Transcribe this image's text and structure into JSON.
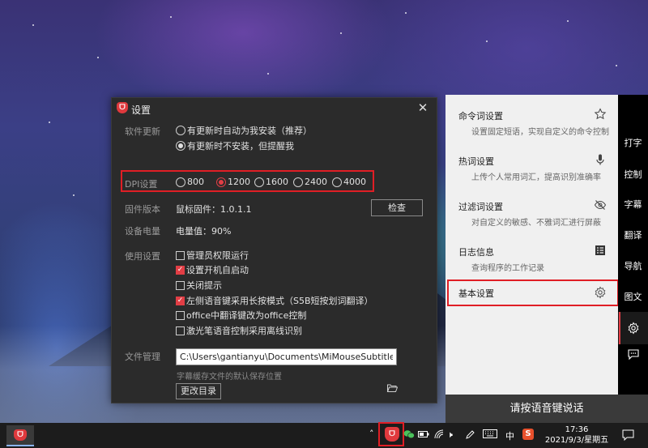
{
  "settings_dialog": {
    "title": "设置",
    "close_label": "✕",
    "software_update": {
      "label": "软件更新",
      "option_auto": "有更新时自动为我安装（推荐）",
      "option_remind": "有更新时不安装，但提醒我",
      "selected": "option_remind"
    },
    "dpi": {
      "label": "DPI设置",
      "options": [
        "800",
        "1200",
        "1600",
        "2400",
        "4000"
      ],
      "selected": "1200"
    },
    "firmware": {
      "label": "固件版本",
      "value": "鼠标固件：1.0.1.1",
      "check_button": "检查"
    },
    "battery": {
      "label": "设备电量",
      "value": "电量值：90%"
    },
    "usage": {
      "label": "使用设置",
      "options": [
        {
          "text": "管理员权限运行",
          "checked": false
        },
        {
          "text": "设置开机自启动",
          "checked": true
        },
        {
          "text": "关闭提示",
          "checked": false
        },
        {
          "text": "左侧语音键采用长按模式（S5B短按划词翻译）",
          "checked": true
        },
        {
          "text": "office中翻译键改为office控制",
          "checked": false
        },
        {
          "text": "激光笔语音控制采用离线识别",
          "checked": false
        }
      ]
    },
    "file_management": {
      "label": "文件管理",
      "path": "C:\\Users\\gantianyu\\Documents\\MiMouseSubtitle",
      "hint": "字幕缓存文件的默认保存位置",
      "change_button": "更改目录",
      "folder_icon": "folder-open-icon"
    }
  },
  "side_panel": {
    "items": [
      {
        "title": "命令词设置",
        "subtitle": "设置固定短语，实现自定义的命令控制",
        "icon": "star-icon"
      },
      {
        "title": "热词设置",
        "subtitle": "上传个人常用词汇，提高识别准确率",
        "icon": "microphone-icon"
      },
      {
        "title": "过滤词设置",
        "subtitle": "对自定义的敏感、不雅词汇进行屏蔽",
        "icon": "eye-off-icon"
      },
      {
        "title": "日志信息",
        "subtitle": "查询程序的工作记录",
        "icon": "log-list-icon"
      },
      {
        "title": "基本设置",
        "subtitle": "",
        "icon": "gear-icon"
      }
    ],
    "voice_prompt": "请按语音键说话"
  },
  "rail": {
    "items": [
      "打字",
      "控制",
      "字幕",
      "翻译",
      "导航",
      "图文"
    ],
    "settings_icon": "gear-icon",
    "chat_icon": "chat-bubble-icon"
  },
  "taskbar": {
    "ime": "中",
    "time": "17:36",
    "date": "2021/9/3/星期五"
  },
  "colors": {
    "highlight_red": "#e01e25",
    "accent_red": "#e23e45",
    "dialog_bg": "#2b2b2b",
    "panel_bg": "#f0f0f0"
  }
}
